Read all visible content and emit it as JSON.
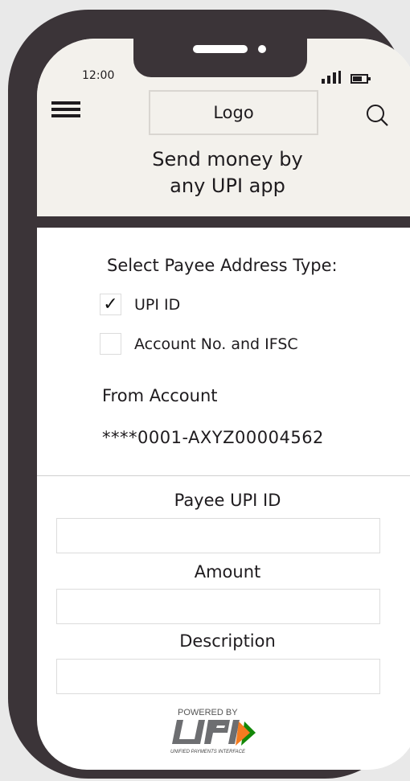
{
  "status_bar": {
    "time": "12:00"
  },
  "header": {
    "logo_text": "Logo",
    "headline_line1": "Send money by",
    "headline_line2": "any UPI app"
  },
  "payee_type": {
    "title": "Select Payee Address Type:",
    "options": [
      {
        "label": "UPI ID",
        "checked": true,
        "mark": "✓"
      },
      {
        "label": "Account No. and IFSC",
        "checked": false
      }
    ]
  },
  "from_account": {
    "label": "From Account",
    "value": "****0001-AXYZ00004562"
  },
  "form": {
    "payee_label": "Payee UPI ID",
    "payee_value": "",
    "amount_label": "Amount",
    "amount_value": "",
    "description_label": "Description",
    "description_value": ""
  },
  "footer": {
    "powered_by": "POWERED BY",
    "upi_subtitle": "UNIFIED PAYMENTS INTERFACE"
  },
  "icons": [
    "menu-icon",
    "search-icon",
    "signal-icon",
    "battery-icon",
    "checkmark-icon",
    "upi-logo"
  ],
  "colors": {
    "frame": "#3b3438",
    "header_bg": "#f3f1ec",
    "upi_orange": "#f47b20",
    "upi_green": "#138808"
  }
}
